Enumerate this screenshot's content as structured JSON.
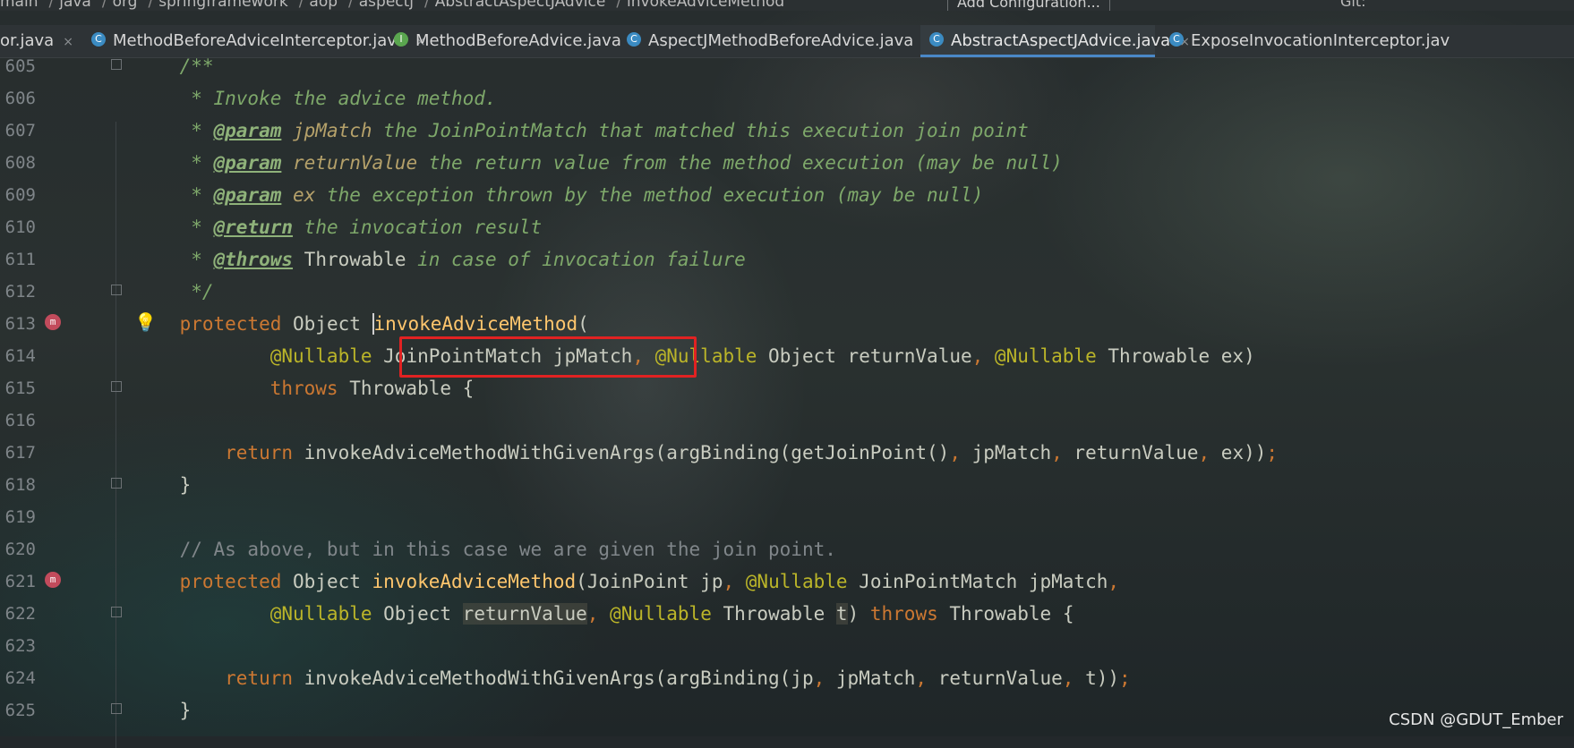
{
  "nav": {
    "crumbs": [
      "main",
      "java",
      "org",
      "springframework",
      "aop",
      "aspectj",
      "AbstractAspectJAdvice",
      "invokeAdviceMethod"
    ],
    "run_config": "Add Configuration...",
    "git_label": "Git:"
  },
  "tabs": [
    {
      "label": "or.java",
      "icon": "",
      "active": false
    },
    {
      "label": "MethodBeforeAdviceInterceptor.java",
      "icon": "C",
      "active": false
    },
    {
      "label": "MethodBeforeAdvice.java",
      "icon": "I",
      "active": false
    },
    {
      "label": "AspectJMethodBeforeAdvice.java",
      "icon": "C",
      "active": false
    },
    {
      "label": "AbstractAspectJAdvice.java",
      "icon": "C",
      "active": true
    },
    {
      "label": "ExposeInvocationInterceptor.jav",
      "icon": "C",
      "active": false
    }
  ],
  "tab_close_glyph": "×",
  "gutter_method_mark": "m",
  "lines": [
    {
      "n": "605",
      "fold": true,
      "tokens": [
        [
          "t-doc",
          "    /**"
        ]
      ]
    },
    {
      "n": "606",
      "tokens": [
        [
          "t-doc",
          "     * Invoke the advice method."
        ]
      ]
    },
    {
      "n": "607",
      "tokens": [
        [
          "t-doc",
          "     * "
        ],
        [
          "t-tag",
          "@param"
        ],
        [
          "t-par",
          " jpMatch"
        ],
        [
          "t-doc",
          " the JoinPointMatch that matched this execution join point"
        ]
      ]
    },
    {
      "n": "608",
      "tokens": [
        [
          "t-doc",
          "     * "
        ],
        [
          "t-tag",
          "@param"
        ],
        [
          "t-par",
          " returnValue"
        ],
        [
          "t-doc",
          " the return value from the method execution (may be null)"
        ]
      ]
    },
    {
      "n": "609",
      "tokens": [
        [
          "t-doc",
          "     * "
        ],
        [
          "t-tag",
          "@param"
        ],
        [
          "t-par",
          " ex"
        ],
        [
          "t-doc",
          " the exception thrown by the method execution (may be null)"
        ]
      ]
    },
    {
      "n": "610",
      "tokens": [
        [
          "t-doc",
          "     * "
        ],
        [
          "t-tag",
          "@return"
        ],
        [
          "t-doc",
          " the invocation result"
        ]
      ]
    },
    {
      "n": "611",
      "tokens": [
        [
          "t-doc",
          "     * "
        ],
        [
          "t-tag",
          "@throws"
        ],
        [
          "t-txt",
          " Throwable"
        ],
        [
          "t-doc",
          " in case of invocation failure"
        ]
      ]
    },
    {
      "n": "612",
      "fold": true,
      "tokens": [
        [
          "t-doc",
          "     */"
        ]
      ]
    },
    {
      "n": "613",
      "mark": true,
      "bulb": true,
      "tokens": [
        [
          "t-kw",
          "    protected "
        ],
        [
          "t-txt",
          "Object "
        ],
        [
          "t-fn caret",
          "invokeAdviceMethod"
        ],
        [
          "t-txt",
          "("
        ]
      ]
    },
    {
      "n": "614",
      "tokens": [
        [
          "t-ann",
          "            @Nullable "
        ],
        [
          "t-txt",
          "JoinPointMatch jpMatch"
        ],
        [
          "t-kw",
          ", "
        ],
        [
          "t-ann",
          "@Nullable "
        ],
        [
          "t-txt",
          "Object returnValue"
        ],
        [
          "t-kw",
          ", "
        ],
        [
          "t-ann",
          "@Nullable "
        ],
        [
          "t-txt",
          "Throwable ex)"
        ]
      ]
    },
    {
      "n": "615",
      "fold": true,
      "tokens": [
        [
          "t-kw",
          "            throws "
        ],
        [
          "t-txt",
          "Throwable {"
        ]
      ]
    },
    {
      "n": "616",
      "tokens": []
    },
    {
      "n": "617",
      "tokens": [
        [
          "t-kw",
          "        return "
        ],
        [
          "t-txt",
          "invokeAdviceMethodWithGivenArgs(argBinding(getJoinPoint()"
        ],
        [
          "t-kw",
          ", "
        ],
        [
          "t-txt",
          "jpMatch"
        ],
        [
          "t-kw",
          ", "
        ],
        [
          "t-txt",
          "returnValue"
        ],
        [
          "t-kw",
          ", "
        ],
        [
          "t-txt",
          "ex))"
        ],
        [
          "t-kw",
          ";"
        ]
      ]
    },
    {
      "n": "618",
      "fold": true,
      "tokens": [
        [
          "t-txt",
          "    }"
        ]
      ]
    },
    {
      "n": "619",
      "tokens": []
    },
    {
      "n": "620",
      "tokens": [
        [
          "t-cmt",
          "    // As above, but in this case we are given the join point."
        ]
      ]
    },
    {
      "n": "621",
      "mark": true,
      "tokens": [
        [
          "t-kw",
          "    protected "
        ],
        [
          "t-txt",
          "Object "
        ],
        [
          "t-fn",
          "invokeAdviceMethod"
        ],
        [
          "t-txt",
          "(JoinPoint jp"
        ],
        [
          "t-kw",
          ", "
        ],
        [
          "t-ann",
          "@Nullable "
        ],
        [
          "t-txt",
          "JoinPointMatch jpMatch"
        ],
        [
          "t-kw",
          ","
        ]
      ]
    },
    {
      "n": "622",
      "fold": true,
      "tokens": [
        [
          "t-ann",
          "            @Nullable "
        ],
        [
          "t-txt",
          "Object "
        ],
        [
          "t-txt usage",
          "returnValue"
        ],
        [
          "t-kw",
          ", "
        ],
        [
          "t-ann",
          "@Nullable "
        ],
        [
          "t-txt",
          "Throwable "
        ],
        [
          "t-txt usage",
          "t"
        ],
        [
          "t-txt",
          ") "
        ],
        [
          "t-kw",
          "throws "
        ],
        [
          "t-txt",
          "Throwable {"
        ]
      ]
    },
    {
      "n": "623",
      "tokens": []
    },
    {
      "n": "624",
      "tokens": [
        [
          "t-kw",
          "        return "
        ],
        [
          "t-txt",
          "invokeAdviceMethodWithGivenArgs(argBinding(jp"
        ],
        [
          "t-kw",
          ", "
        ],
        [
          "t-txt",
          "jpMatch"
        ],
        [
          "t-kw",
          ", "
        ],
        [
          "t-txt",
          "returnValue"
        ],
        [
          "t-kw",
          ", "
        ],
        [
          "t-txt",
          "t))"
        ],
        [
          "t-kw",
          ";"
        ]
      ]
    },
    {
      "n": "625",
      "fold": true,
      "tokens": [
        [
          "t-txt",
          "    }"
        ]
      ]
    }
  ],
  "watermark": "CSDN @GDUT_Ember",
  "colors": {
    "highlight_box": "#e12222",
    "active_tab_underline": "#4a88c7"
  }
}
